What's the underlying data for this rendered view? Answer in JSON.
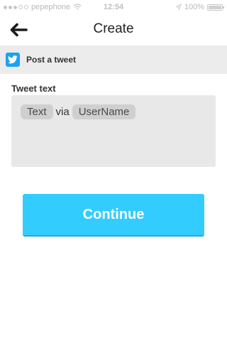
{
  "status_bar": {
    "carrier": "pepephone",
    "time": "12:54",
    "battery": "100%",
    "battery_level": 1.0
  },
  "nav": {
    "title": "Create",
    "back_icon": "arrow-left-icon"
  },
  "service": {
    "icon": "twitter-icon",
    "label": "Post a tweet",
    "accent_color": "#1da1f2"
  },
  "form": {
    "field_label": "Tweet text",
    "tokens": {
      "first": "Text",
      "joiner": "via",
      "second": "UserName"
    }
  },
  "actions": {
    "continue_label": "Continue",
    "continue_color": "#33ccff"
  }
}
